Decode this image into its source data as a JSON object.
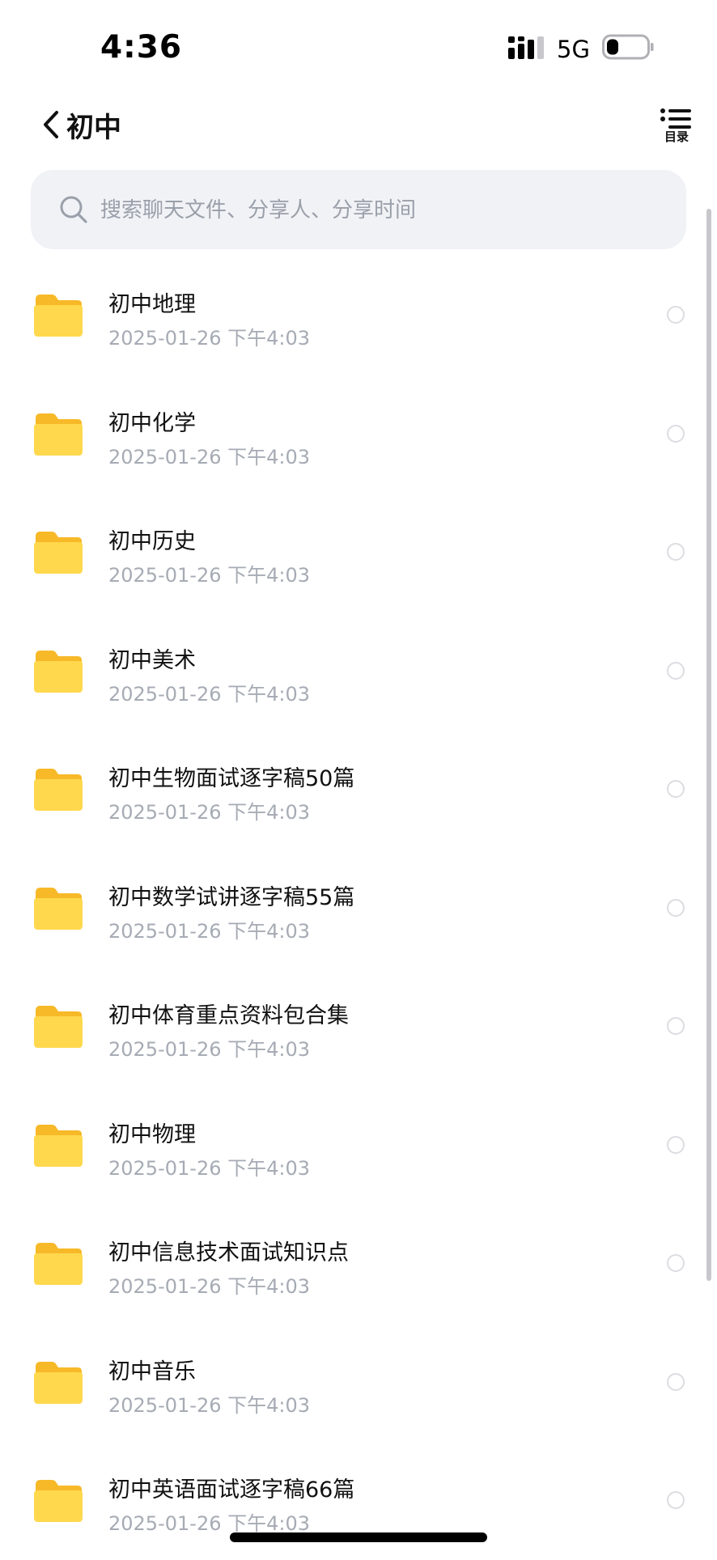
{
  "status_bar": {
    "time": "4:36",
    "network": "5G"
  },
  "header": {
    "back_label": "初中",
    "toc_label": "目录"
  },
  "search": {
    "placeholder": "搜索聊天文件、分享人、分享时间",
    "value": ""
  },
  "files": [
    {
      "name": "初中地理",
      "date": "2025-01-26 下午4:03"
    },
    {
      "name": "初中化学",
      "date": "2025-01-26 下午4:03"
    },
    {
      "name": "初中历史",
      "date": "2025-01-26 下午4:03"
    },
    {
      "name": "初中美术",
      "date": "2025-01-26 下午4:03"
    },
    {
      "name": "初中生物面试逐字稿50篇",
      "date": "2025-01-26 下午4:03"
    },
    {
      "name": "初中数学试讲逐字稿55篇",
      "date": "2025-01-26 下午4:03"
    },
    {
      "name": "初中体育重点资料包合集",
      "date": "2025-01-26 下午4:03"
    },
    {
      "name": "初中物理",
      "date": "2025-01-26 下午4:03"
    },
    {
      "name": "初中信息技术面试知识点",
      "date": "2025-01-26 下午4:03"
    },
    {
      "name": "初中音乐",
      "date": "2025-01-26 下午4:03"
    },
    {
      "name": "初中英语面试逐字稿66篇",
      "date": "2025-01-26 下午4:03"
    }
  ],
  "colors": {
    "folder": "#ffcf3a",
    "folder_front": "#ffd84d",
    "secondary_text": "#a6abb4",
    "search_bg": "#f1f2f6"
  }
}
